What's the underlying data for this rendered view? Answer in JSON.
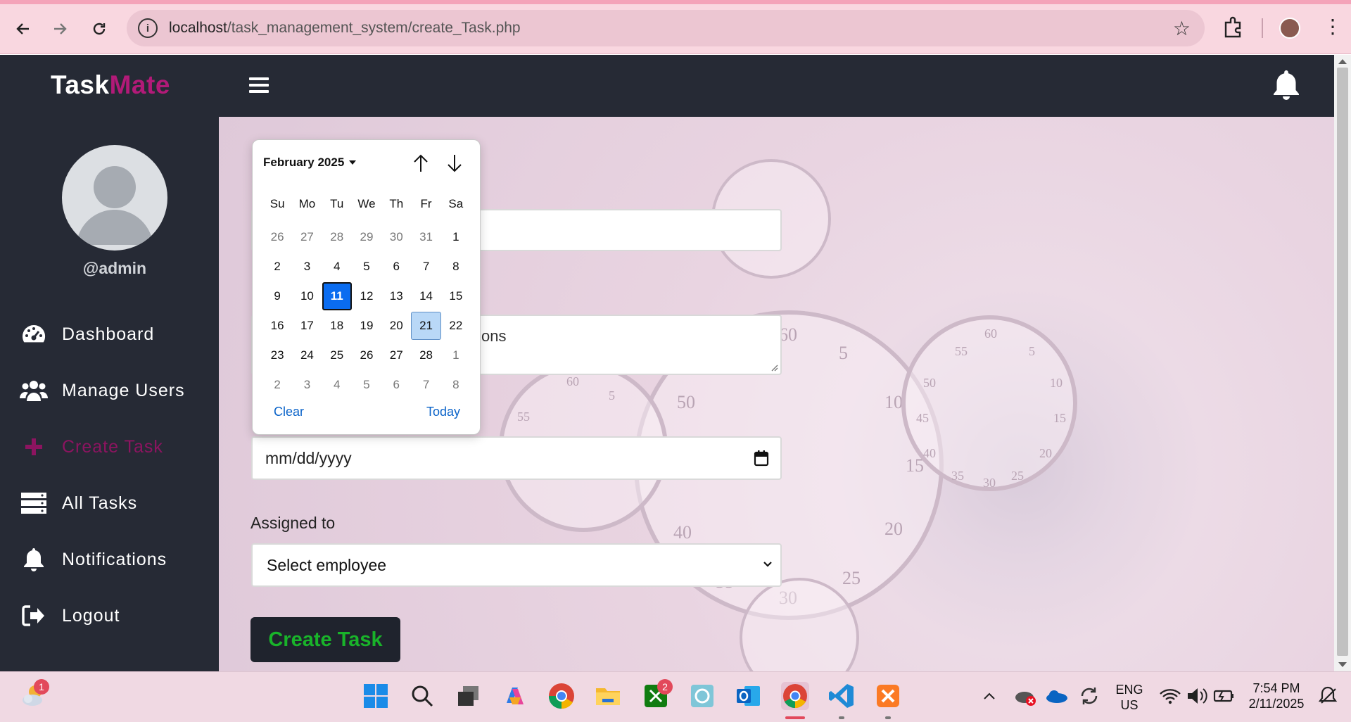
{
  "browser": {
    "url_host": "localhost",
    "url_path": "/task_management_system/create_Task.php"
  },
  "app": {
    "logo_part1": "Task",
    "logo_part2": "Mate",
    "username": "@admin"
  },
  "sidebar": {
    "items": [
      {
        "label": "Dashboard",
        "icon": "dashboard-icon"
      },
      {
        "label": "Manage Users",
        "icon": "users-icon"
      },
      {
        "label": "Create Task",
        "icon": "plus-icon",
        "active": true
      },
      {
        "label": "All Tasks",
        "icon": "list-icon"
      },
      {
        "label": "Notifications",
        "icon": "bell-icon"
      },
      {
        "label": "Logout",
        "icon": "logout-icon"
      }
    ]
  },
  "form": {
    "description_visible_text": "tions",
    "due_date_placeholder": "mm/dd/yyyy",
    "assigned_label": "Assigned to",
    "assigned_value": "Select employee",
    "submit_label": "Create Task"
  },
  "calendar": {
    "month_label": "February 2025",
    "weekdays": [
      "Su",
      "Mo",
      "Tu",
      "We",
      "Th",
      "Fr",
      "Sa"
    ],
    "weeks": [
      [
        {
          "d": "26",
          "o": 1
        },
        {
          "d": "27",
          "o": 1
        },
        {
          "d": "28",
          "o": 1
        },
        {
          "d": "29",
          "o": 1
        },
        {
          "d": "30",
          "o": 1
        },
        {
          "d": "31",
          "o": 1
        },
        {
          "d": "1"
        }
      ],
      [
        {
          "d": "2"
        },
        {
          "d": "3"
        },
        {
          "d": "4"
        },
        {
          "d": "5"
        },
        {
          "d": "6"
        },
        {
          "d": "7"
        },
        {
          "d": "8"
        }
      ],
      [
        {
          "d": "9"
        },
        {
          "d": "10"
        },
        {
          "d": "11",
          "today": 1
        },
        {
          "d": "12"
        },
        {
          "d": "13"
        },
        {
          "d": "14"
        },
        {
          "d": "15"
        }
      ],
      [
        {
          "d": "16"
        },
        {
          "d": "17"
        },
        {
          "d": "18"
        },
        {
          "d": "19"
        },
        {
          "d": "20"
        },
        {
          "d": "21",
          "selected": 1
        },
        {
          "d": "22"
        }
      ],
      [
        {
          "d": "23"
        },
        {
          "d": "24"
        },
        {
          "d": "25"
        },
        {
          "d": "26"
        },
        {
          "d": "27"
        },
        {
          "d": "28"
        },
        {
          "d": "1",
          "o": 1
        }
      ],
      [
        {
          "d": "2",
          "o": 1
        },
        {
          "d": "3",
          "o": 1
        },
        {
          "d": "4",
          "o": 1
        },
        {
          "d": "5",
          "o": 1
        },
        {
          "d": "6",
          "o": 1
        },
        {
          "d": "7",
          "o": 1
        },
        {
          "d": "8",
          "o": 1
        }
      ]
    ],
    "clear_label": "Clear",
    "today_label": "Today"
  },
  "taskbar": {
    "weather_badge": "1",
    "xbox_badge": "2",
    "lang_line1": "ENG",
    "lang_line2": "US",
    "time": "7:54 PM",
    "date": "2/11/2025"
  },
  "colors": {
    "accent": "#b21a78",
    "sidebar_bg": "#262a35",
    "submit_text": "#19b32a",
    "today_bg": "#0a6cf0"
  }
}
